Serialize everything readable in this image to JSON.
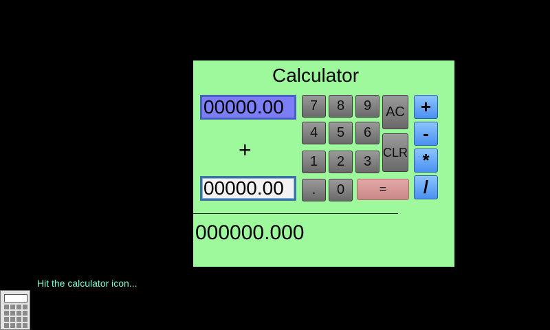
{
  "calculator": {
    "title": "Calculator",
    "operand_a": "00000.00",
    "operand_b": "00000.00",
    "operator": "+",
    "result": "000000.000",
    "keys": {
      "k7": "7",
      "k8": "8",
      "k9": "9",
      "k4": "4",
      "k5": "5",
      "k6": "6",
      "k1": "1",
      "k2": "2",
      "k3": "3",
      "dot": ".",
      "k0": "0"
    },
    "ac_label": "AC",
    "clr_label": "CLR",
    "equals_label": "=",
    "ops": {
      "plus": "+",
      "minus": "-",
      "multiply": "*",
      "divide": "/"
    }
  },
  "hint_text": "Hit the calculator icon...",
  "colors": {
    "background": "#000000",
    "panel": "#9df99b",
    "operand_a_bg": "#7c7ef7",
    "operator_buttons": "#4a90f0",
    "equals_button": "#d99a9a",
    "hint": "#7fffd4"
  },
  "icons": [
    "calculator-icon"
  ]
}
